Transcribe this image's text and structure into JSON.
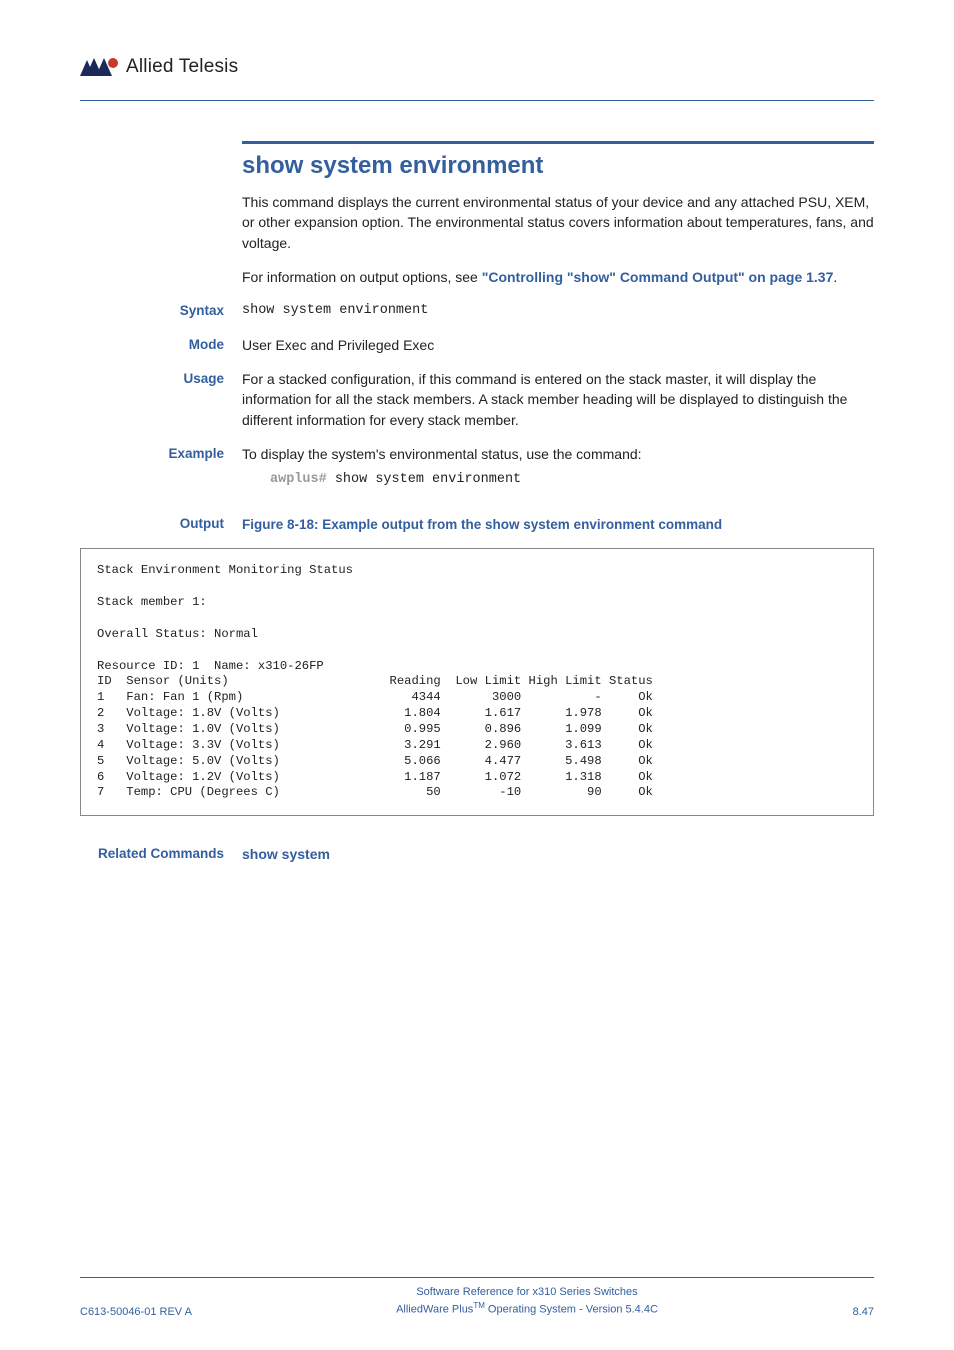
{
  "brand": {
    "name": "Allied Telesis"
  },
  "title": "show system environment",
  "intro": {
    "p1": "This command displays the current environmental status of your device and any attached PSU, XEM, or other expansion option. The environmental status covers information about temperatures, fans, and voltage.",
    "p2_prefix": "For information on output options, see ",
    "p2_link": "\"Controlling \"show\" Command Output\" on page 1.37",
    "p2_suffix": "."
  },
  "labels": {
    "syntax": "Syntax",
    "mode": "Mode",
    "usage": "Usage",
    "example": "Example",
    "output": "Output",
    "related": "Related Commands"
  },
  "syntax_cmd": "show system environment",
  "mode_text": "User Exec and Privileged Exec",
  "usage_text": "For a stacked configuration, if this command is entered on the stack master, it will display the information for all the stack members. A stack member heading will be displayed to distinguish the different information for every stack member.",
  "example_text": "To display the system's environmental status, use the command:",
  "example_prompt": "awplus#",
  "example_cmd": " show system environment",
  "figure_caption": "Figure 8-18: Example output from the show system environment command",
  "output_block": "Stack Environment Monitoring Status\n\nStack member 1:\n\nOverall Status: Normal\n\nResource ID: 1  Name: x310-26FP\nID  Sensor (Units)                      Reading  Low Limit High Limit Status\n1   Fan: Fan 1 (Rpm)                       4344       3000          -     Ok\n2   Voltage: 1.8V (Volts)                 1.804      1.617      1.978     Ok\n3   Voltage: 1.0V (Volts)                 0.995      0.896      1.099     Ok\n4   Voltage: 3.3V (Volts)                 3.291      2.960      3.613     Ok\n5   Voltage: 5.0V (Volts)                 5.066      4.477      5.498     Ok\n6   Voltage: 1.2V (Volts)                 1.187      1.072      1.318     Ok\n7   Temp: CPU (Degrees C)                    50        -10         90     Ok",
  "related_link": "show system",
  "footer": {
    "left": "C613-50046-01 REV A",
    "center1": "Software Reference for x310 Series Switches",
    "center2_pre": "AlliedWare Plus",
    "center2_tm": "TM",
    "center2_post": " Operating System - Version 5.4.4C",
    "right": "8.47"
  }
}
